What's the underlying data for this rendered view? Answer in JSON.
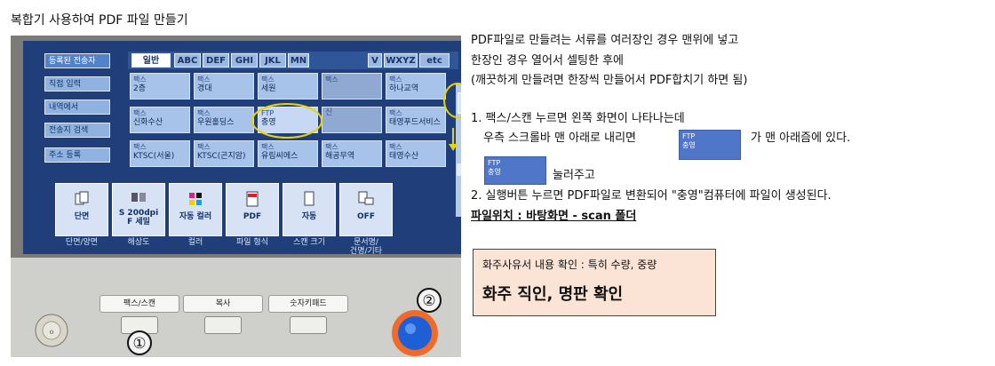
{
  "title": "복합기 사용하여 PDF 파일 만들기",
  "device": {
    "sidebar": [
      "등록된 전송자",
      "직접 입력",
      "내역에서",
      "전송지 검색",
      "주소 등록"
    ],
    "tabs": [
      "일반",
      "ABC",
      "DEF",
      "GHI",
      "JKL",
      "MN",
      "V",
      "WXYZ",
      "etc"
    ],
    "grid": [
      {
        "type": "팩스",
        "name": "2층"
      },
      {
        "type": "팩스",
        "name": "경대"
      },
      {
        "type": "팩스",
        "name": "세원"
      },
      {
        "type": "팩스",
        "name": ""
      },
      {
        "type": "팩스",
        "name": "하나교역"
      },
      {
        "type": "팩스",
        "name": "신화수산"
      },
      {
        "type": "팩스",
        "name": "우원홀딩스"
      },
      {
        "type": "FTP",
        "name": "충영"
      },
      {
        "type": "",
        "name": "신"
      },
      {
        "type": "팩스",
        "name": "태영푸드서비스"
      },
      {
        "type": "팩스",
        "name": "KTSC(서울)"
      },
      {
        "type": "팩스",
        "name": "KTSC(곤지암)"
      },
      {
        "type": "팩스",
        "name": "유림씨에스"
      },
      {
        "type": "팩스",
        "name": "해공무역"
      },
      {
        "type": "팩스",
        "name": "태영수산"
      }
    ],
    "functions": [
      {
        "label": "단면",
        "caption": "단면/양면"
      },
      {
        "label": "S 200dpi\nF 세밀",
        "caption": "해상도"
      },
      {
        "label": "자동 컬러",
        "caption": "컬러"
      },
      {
        "label": "PDF",
        "caption": "파일 형식"
      },
      {
        "label": "자동",
        "caption": "스캔 크기"
      },
      {
        "label": "OFF",
        "caption": "문서명/\n건명/기타"
      }
    ],
    "hardware_keys": [
      "팩스/스캔",
      "복사",
      "숫자키패드"
    ],
    "markers": [
      "①",
      "②"
    ]
  },
  "intro": [
    "PDF파일로 만들려는 서류를 여러장인 경우 맨위에 넣고",
    "한장인 경우 열어서 셀팅한 후에",
    "(깨끗하게 만들려면 한장씩 만들어서 PDF합치기 하면 됨)"
  ],
  "steps": {
    "step1a": "1. 팩스/스캔 누르면 왼쪽 화면이 나타나는데",
    "step1b": "우측 스크롤바 맨 아래로 내리면",
    "step1c": "가 맨 아래즘에 있다.",
    "step1d": "눌러주고",
    "step2": "2. 실행버튼 누르면 PDF파일로 변환되어 \"충영\"컴퓨터에 파일이 생성된다.",
    "location": "파일위치 : 바탕화면 - scan 폴더"
  },
  "chip": {
    "type": "FTP",
    "name": "충영"
  },
  "note": {
    "line1": "화주사유서 내용 확인 : 특히 수량, 중량",
    "line2": "화주 직인, 명판 확인"
  },
  "colors": {
    "screen": "#1f3e7a",
    "highlight": "#e8d400",
    "note_bg": "#fbe4d6",
    "start_button": "#1e5fd6"
  }
}
